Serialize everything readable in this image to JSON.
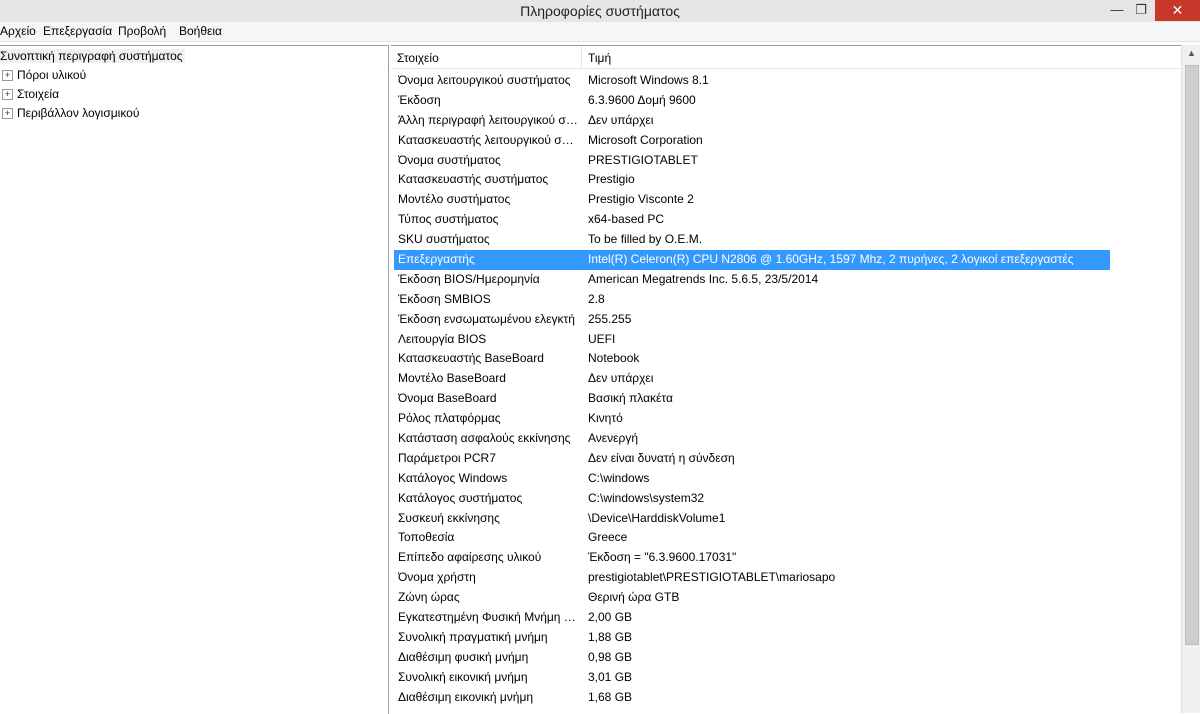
{
  "window": {
    "title": "Πληροφορίες συστήματος",
    "min_glyph": "—",
    "max_glyph": "❐",
    "close_glyph": "✕",
    "scroll_up_glyph": "▲"
  },
  "menu": [
    "Αρχείο",
    "Επεξεργασία",
    "Προβολή",
    "Βοήθεια"
  ],
  "tree": {
    "root": "Συνοπτική περιγραφή συστήματος",
    "expander": "+",
    "children": [
      "Πόροι υλικού",
      "Στοιχεία",
      "Περιβάλλον λογισμικού"
    ]
  },
  "table": {
    "headers": [
      "Στοιχείο",
      "Τιμή"
    ],
    "selected_index": 9,
    "rows": [
      [
        "Όνομα λειτουργικού συστήματος",
        "Microsoft Windows 8.1"
      ],
      [
        "Έκδοση",
        "6.3.9600 Δομή 9600"
      ],
      [
        "Άλλη περιγραφή λειτουργικού συστήματος",
        "Δεν υπάρχει"
      ],
      [
        "Κατασκευαστής λειτουργικού συστήματος",
        "Microsoft Corporation"
      ],
      [
        "Όνομα συστήματος",
        "PRESTIGIOTABLET"
      ],
      [
        "Κατασκευαστής συστήματος",
        "Prestigio"
      ],
      [
        "Μοντέλο συστήματος",
        "Prestigio Visconte 2"
      ],
      [
        "Τύπος συστήματος",
        "x64-based PC"
      ],
      [
        "SKU συστήματος",
        "To be filled by O.E.M."
      ],
      [
        "Επεξεργαστής",
        "Intel(R) Celeron(R) CPU  N2806  @ 1.60GHz, 1597 Mhz, 2 πυρήνες, 2 λογικοί επεξεργαστές"
      ],
      [
        "Έκδοση BIOS/Ημερομηνία",
        "American Megatrends Inc. 5.6.5, 23/5/2014"
      ],
      [
        "Έκδοση SMBIOS",
        "2.8"
      ],
      [
        "Έκδοση ενσωματωμένου ελεγκτή",
        "255.255"
      ],
      [
        "Λειτουργία BIOS",
        "UEFI"
      ],
      [
        "Κατασκευαστής BaseBoard",
        "Notebook"
      ],
      [
        "Μοντέλο BaseBoard",
        "Δεν υπάρχει"
      ],
      [
        "Όνομα BaseBoard",
        "Βασική πλακέτα"
      ],
      [
        "Ρόλος πλατφόρμας",
        "Κινητό"
      ],
      [
        "Κατάσταση ασφαλούς εκκίνησης",
        "Ανενεργή"
      ],
      [
        "Παράμετροι PCR7",
        "Δεν είναι δυνατή η σύνδεση"
      ],
      [
        "Κατάλογος Windows",
        "C:\\windows"
      ],
      [
        "Κατάλογος συστήματος",
        "C:\\windows\\system32"
      ],
      [
        "Συσκευή εκκίνησης",
        "\\Device\\HarddiskVolume1"
      ],
      [
        "Τοποθεσία",
        "Greece"
      ],
      [
        "Επίπεδο αφαίρεσης υλικού",
        "Έκδοση = \"6.3.9600.17031\""
      ],
      [
        "Όνομα χρήστη",
        "prestigiotablet\\PRESTIGIOTABLET\\mariosapo"
      ],
      [
        "Ζώνη ώρας",
        "Θερινή ώρα GTB"
      ],
      [
        "Εγκατεστημένη Φυσική Μνήμη (RAM)",
        "2,00 GB"
      ],
      [
        "Συνολική πραγματική μνήμη",
        "1,88 GB"
      ],
      [
        "Διαθέσιμη φυσική μνήμη",
        "0,98 GB"
      ],
      [
        "Συνολική εικονική μνήμη",
        "3,01 GB"
      ],
      [
        "Διαθέσιμη εικονική μνήμη",
        "1,68 GB"
      ]
    ]
  }
}
